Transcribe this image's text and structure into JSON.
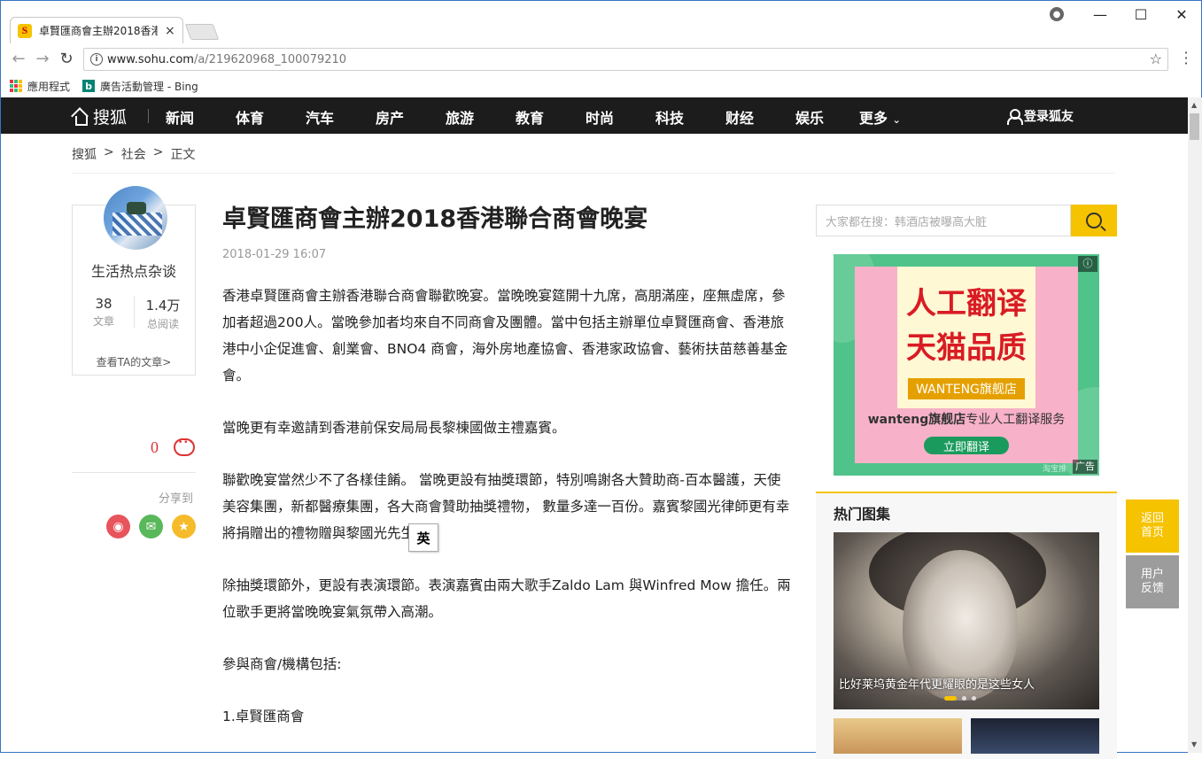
{
  "browser": {
    "tab_title": "卓賢匯商會主辦2018香港",
    "tab_close": "×",
    "url_host": "www.sohu.com",
    "url_path": "/a/219620968_100079210",
    "bookmarks": [
      {
        "label": "應用程式",
        "icon": "apps-icon"
      },
      {
        "label": "廣告活動管理 - Bing",
        "icon": "bing-icon"
      }
    ],
    "window_controls": {
      "minimize": "—",
      "maximize": "☐",
      "close": "✕"
    }
  },
  "topnav": {
    "logo": "搜狐",
    "items": [
      "新闻",
      "体育",
      "汽车",
      "房产",
      "旅游",
      "教育",
      "时尚",
      "科技",
      "财经",
      "娱乐",
      "更多"
    ],
    "login": "登录狐友"
  },
  "breadcrumb": {
    "items": [
      "搜狐",
      ">",
      "社会",
      ">",
      "正文"
    ]
  },
  "author": {
    "name": "生活热点杂谈",
    "articles_count": "38",
    "articles_label": "文章",
    "reads_count": "1.4万",
    "reads_label": "总阅读",
    "view_more": "查看TA的文章>"
  },
  "comments": {
    "count": "0"
  },
  "share": {
    "label": "分享到",
    "colors": {
      "weibo": "#e8545c",
      "wechat": "#58b85a",
      "favorite": "#f5bb2a"
    }
  },
  "article": {
    "title": "卓賢匯商會主辦2018香港聯合商會晚宴",
    "date": "2018-01-29 16:07",
    "paragraphs": [
      "香港卓賢匯商會主辦香港聯合商會聯歡晚宴。當晚晚宴筵開十九席，高朋滿座，座無虛席，參加者超過200人。當晚參加者均來自不同商會及團體。當中包括主辦單位卓賢匯商會、香港旅港中小企促進會、創業會、BNO4 商會，海外房地產協會、香港家政協會、藝術扶苗慈善基金會。",
      "當晚更有幸邀請到香港前保安局局長黎棟國做主禮嘉賓。",
      "聯歡晚宴當然少不了各樣佳餚。 當晚更設有抽獎環節，特別鳴謝各大贊助商-百本醫護，天使美容集團，新都醫療集團，各大商會贊助抽獎禮物， 數量多達一百份。嘉賓黎國光律師更有幸將捐贈出的禮物贈與黎國光先生。",
      "除抽獎環節外，更設有表演環節。表演嘉賓由兩大歌手Zaldo Lam 與Winfred Mow 擔任。兩位歌手更將當晚晚宴氣氛帶入高潮。",
      "參與商會/機構包括:",
      "1.卓賢匯商會"
    ]
  },
  "ime": {
    "label": "英"
  },
  "search": {
    "placeholder": "大家都在搜：韩酒店被曝高大脏"
  },
  "ad": {
    "line1": "人工翻译",
    "line2": "天猫品质",
    "shop": "WANTENG旗舰店",
    "desc_bold": "wanteng旗舰店",
    "desc": "专业人工翻译服务",
    "button": "立即翻译",
    "label": "广告",
    "source": "淘宝推"
  },
  "hot": {
    "title": "热门图集",
    "caption": "比好莱坞黄金年代更耀眼的是这些女人"
  },
  "float": {
    "back_home": [
      "返回",
      "首页"
    ],
    "feedback": [
      "用户",
      "反馈"
    ]
  }
}
